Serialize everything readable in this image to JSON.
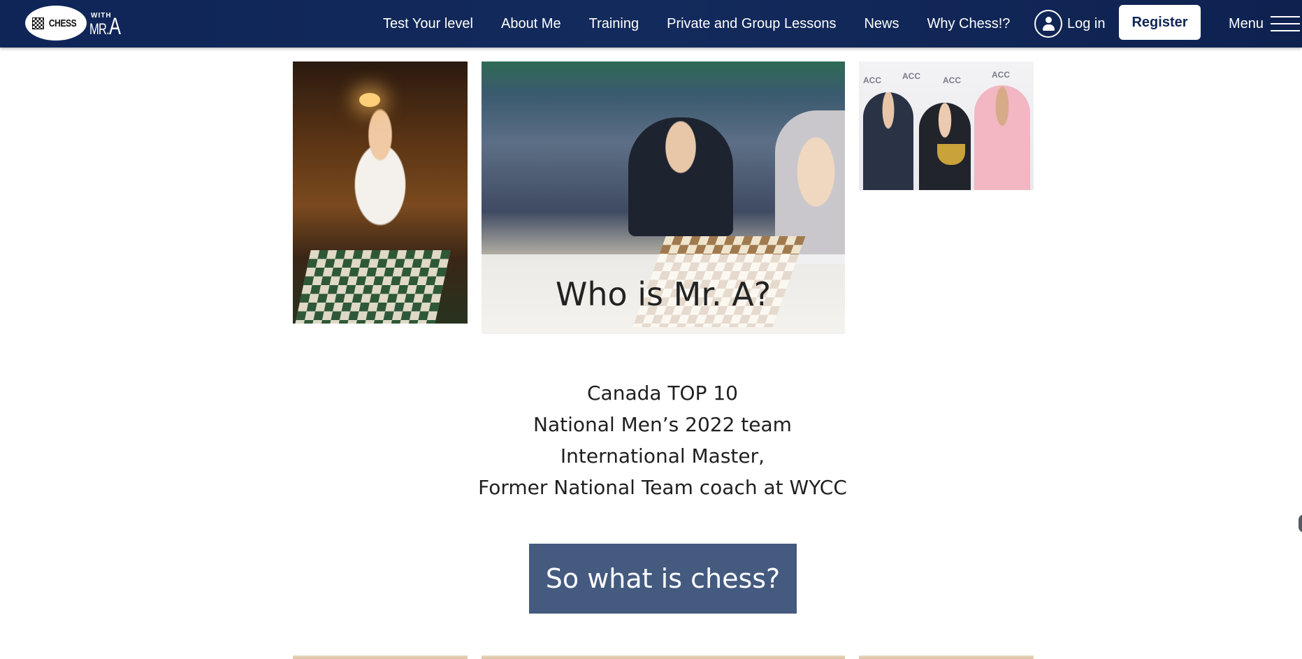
{
  "header": {
    "logo": {
      "chess_word": "CHESS",
      "with_word": "WITH",
      "mr_word": "MR.",
      "a_word": "A"
    },
    "nav": [
      {
        "label": "Test Your level"
      },
      {
        "label": "About Me"
      },
      {
        "label": "Training"
      },
      {
        "label": "Private and Group Lessons"
      },
      {
        "label": "News"
      },
      {
        "label": "Why Chess!?"
      }
    ],
    "login_label": "Log in",
    "register_label": "Register",
    "menu_label": "Menu"
  },
  "hero": {
    "title": "Who is Mr. A?",
    "photo_right_logo_text": "ACC"
  },
  "credentials": [
    "Canada TOP 10",
    "National Men’s 2022 team",
    "International Master,",
    "Former National Team coach at WYCC"
  ],
  "cta": {
    "label": "So what is chess?"
  },
  "colors": {
    "header_bg": "#0f2557",
    "cta_bg": "#445a7f",
    "text": "#1f1f1f"
  }
}
